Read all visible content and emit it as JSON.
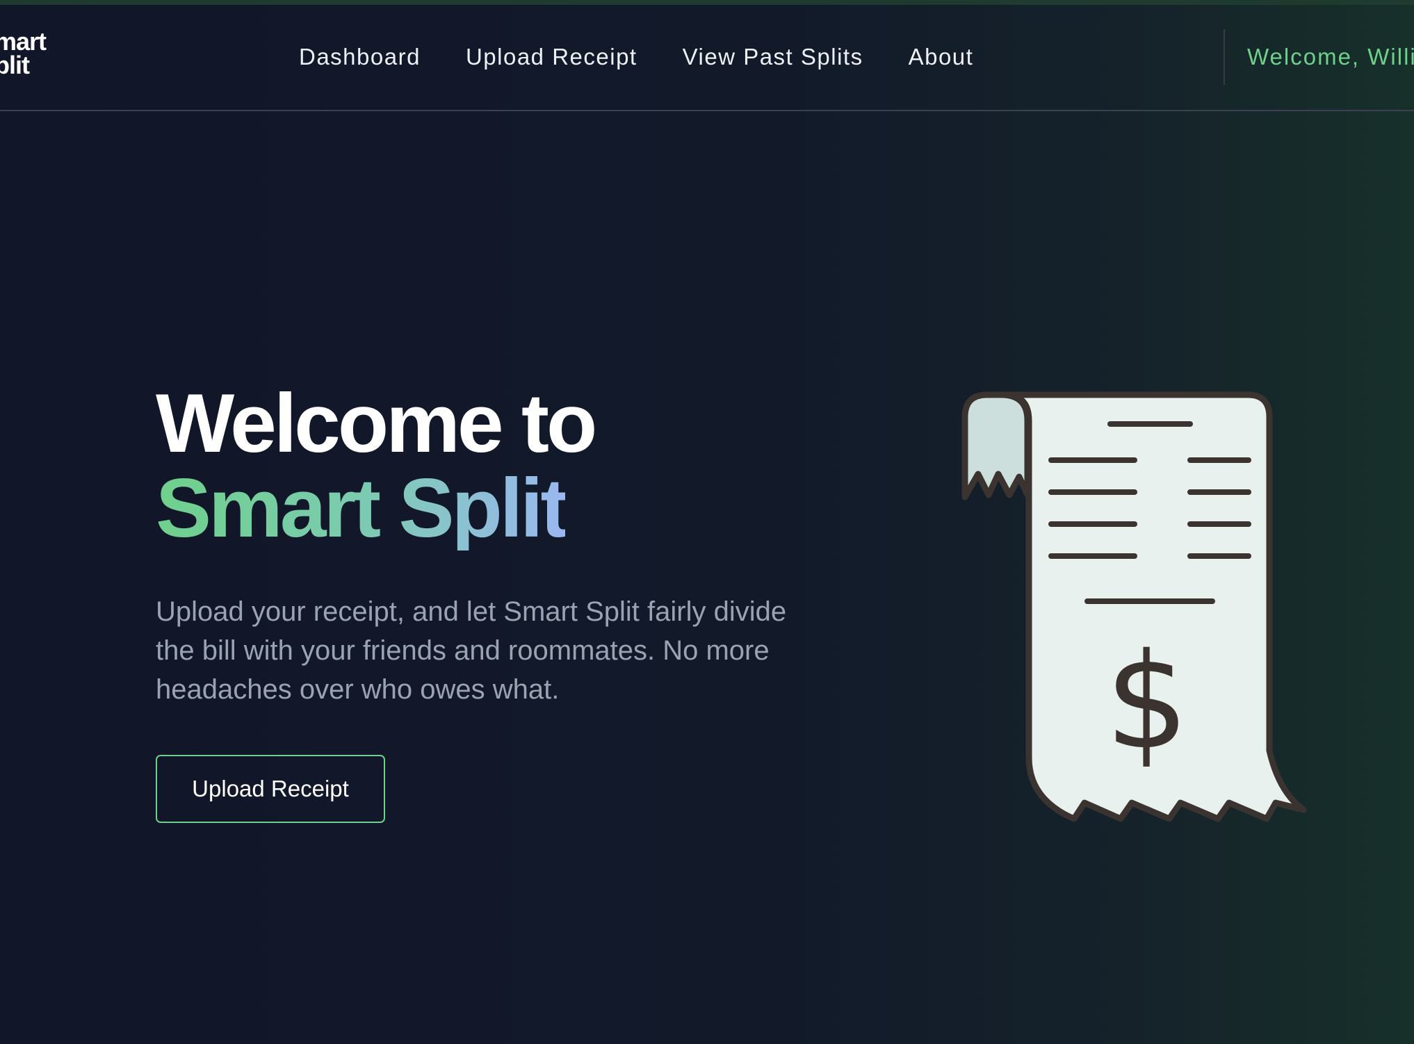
{
  "nav": {
    "logo_line1": "mart",
    "logo_line2": "plit",
    "links": [
      "Dashboard",
      "Upload Receipt",
      "View Past Splits",
      "About"
    ],
    "welcome": "Welcome, Willi"
  },
  "hero": {
    "title_line1": "Welcome to",
    "title_line2": "Smart Split",
    "description": "Upload your receipt, and let Smart Split fairly divide the bill with your friends and roommates. No more headaches over who owes what.",
    "cta_label": "Upload Receipt"
  },
  "illustration": {
    "icon": "receipt-dollar-icon",
    "symbol": "$"
  },
  "colors": {
    "accent_green": "#6fd08c",
    "accent_blue": "#9ab8f0",
    "background": "#111628",
    "text_muted": "#9aa3b2",
    "receipt_paper": "#e9f1ef",
    "receipt_fold": "#cddfdc",
    "receipt_ink": "#3a3330"
  }
}
